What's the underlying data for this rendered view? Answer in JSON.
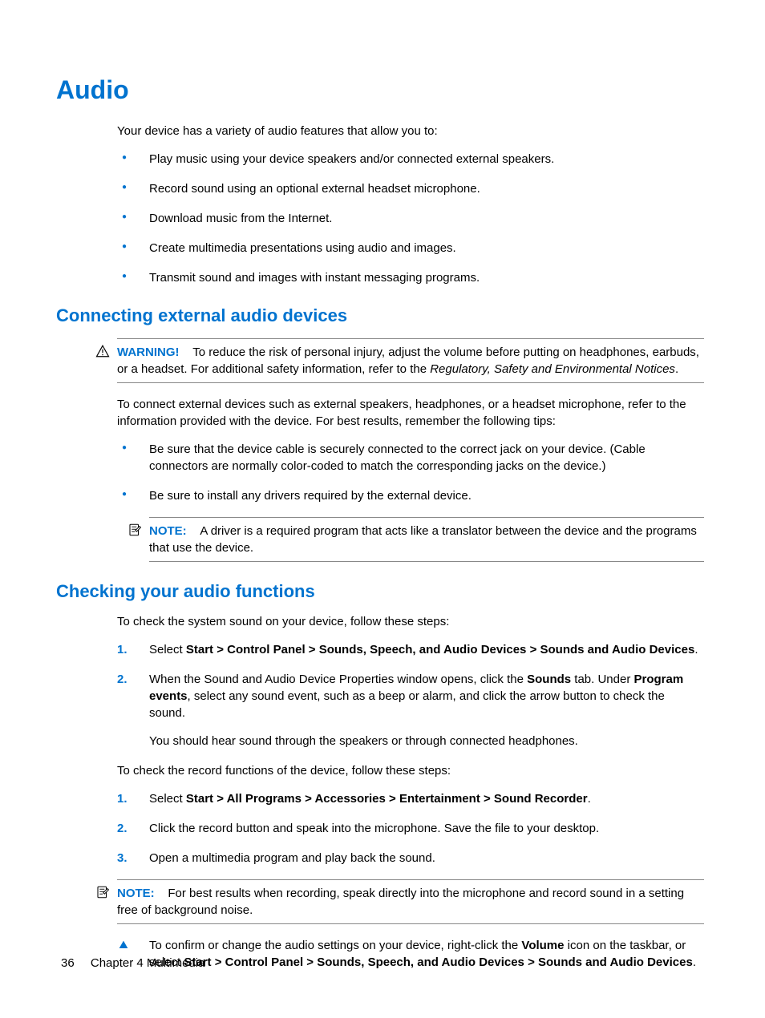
{
  "title": "Audio",
  "intro": "Your device has a variety of audio features that allow you to:",
  "feature_bullets": [
    "Play music using your device speakers and/or connected external speakers.",
    "Record sound using an optional external headset microphone.",
    "Download music from the Internet.",
    "Create multimedia presentations using audio and images.",
    "Transmit sound and images with instant messaging programs."
  ],
  "section1": {
    "heading": "Connecting external audio devices",
    "warning": {
      "label": "WARNING!",
      "pre": "To reduce the risk of personal injury, adjust the volume before putting on headphones, earbuds, or a headset. For additional safety information, refer to the ",
      "italic": "Regulatory, Safety and Environmental Notices",
      "post": "."
    },
    "para": "To connect external devices such as external speakers, headphones, or a headset microphone, refer to the information provided with the device. For best results, remember the following tips:",
    "bullets": [
      "Be sure that the device cable is securely connected to the correct jack on your device. (Cable connectors are normally color-coded to match the corresponding jacks on the device.)",
      "Be sure to install any drivers required by the external device."
    ],
    "note": {
      "label": "NOTE:",
      "text": "A driver is a required program that acts like a translator between the device and the programs that use the device."
    }
  },
  "section2": {
    "heading": "Checking your audio functions",
    "para1": "To check the system sound on your device, follow these steps:",
    "steps_a": [
      {
        "pre": "Select ",
        "bold": "Start > Control Panel > Sounds, Speech, and Audio Devices > Sounds and Audio Devices",
        "post": "."
      },
      {
        "pre": "When the Sound and Audio Device Properties window opens, click the ",
        "bold1": "Sounds",
        "mid": " tab. Under ",
        "bold2": "Program events",
        "post": ", select any sound event, such as a beep or alarm, and click the arrow button to check the sound.",
        "sub": "You should hear sound through the speakers or through connected headphones."
      }
    ],
    "para2": "To check the record functions of the device, follow these steps:",
    "steps_b": [
      {
        "pre": "Select ",
        "bold": "Start > All Programs > Accessories > Entertainment > Sound Recorder",
        "post": "."
      },
      {
        "text": "Click the record button and speak into the microphone. Save the file to your desktop."
      },
      {
        "text": "Open a multimedia program and play back the sound."
      }
    ],
    "note": {
      "label": "NOTE:",
      "text": "For best results when recording, speak directly into the microphone and record sound in a setting free of background noise."
    },
    "confirm": {
      "pre": "To confirm or change the audio settings on your device, right-click the ",
      "bold1": "Volume",
      "mid": " icon on the taskbar, or select ",
      "bold2": "Start > Control Panel > Sounds, Speech, and Audio Devices > Sounds and Audio Devices",
      "post": "."
    }
  },
  "footer": {
    "page": "36",
    "chapter": "Chapter 4   Multimedia"
  }
}
